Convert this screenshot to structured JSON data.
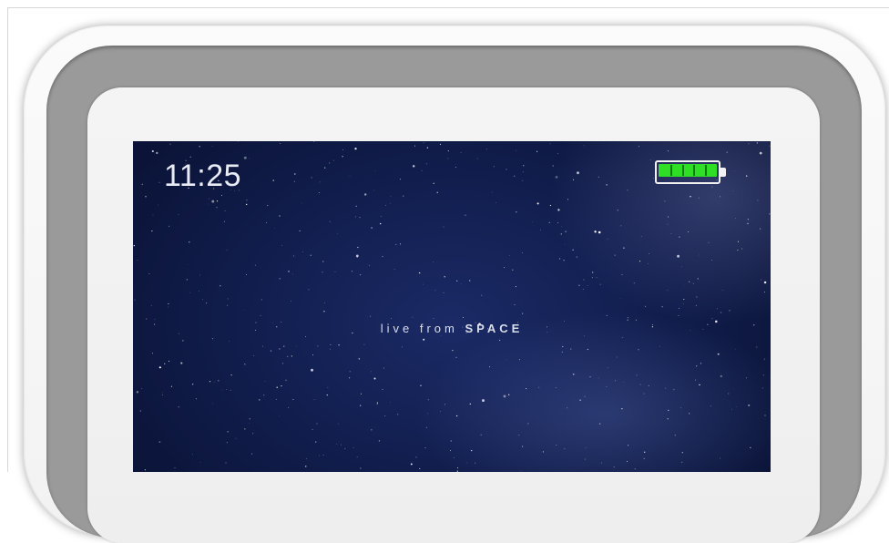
{
  "status_bar": {
    "time": "11:25",
    "battery": {
      "level": 1.0,
      "icon": "battery-full-icon",
      "fill_color": "#2fdf25"
    }
  },
  "screen": {
    "tagline_prefix": "live from ",
    "tagline_emphasis": "SPACE",
    "background_icon": "starfield-wallpaper"
  },
  "device": {
    "outer_color": "#f5f5f5",
    "bezel_color": "#9a9a9a",
    "inner_color": "#f0f0f0"
  }
}
